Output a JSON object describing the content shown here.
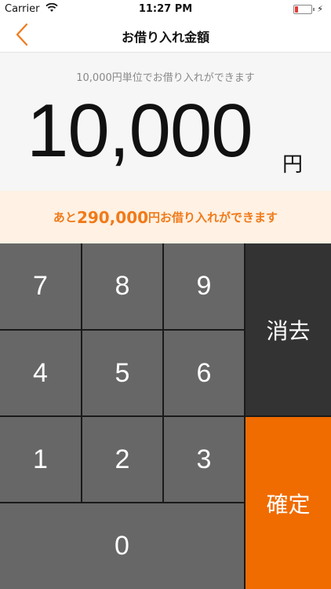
{
  "status_bar": {
    "carrier": "Carrier",
    "time": "11:27 PM",
    "battery_level": 0.15,
    "battery_color": "#e53935"
  },
  "nav": {
    "title": "お借り入れ金額",
    "back_icon": "chevron-left-icon",
    "accent": "#f07a1a"
  },
  "amount": {
    "hint": "10,000円単位でお借り入れができます",
    "value": "10,000",
    "unit": "円"
  },
  "remaining": {
    "prefix": "あと",
    "amount": "290,000",
    "unit": "円",
    "suffix": "お借り入れができます",
    "color": "#f07a1a"
  },
  "keypad": {
    "keys": [
      "7",
      "8",
      "9",
      "4",
      "5",
      "6",
      "1",
      "2",
      "3",
      "0"
    ],
    "delete_label": "消去",
    "confirm_label": "確定",
    "key_color": "#676767",
    "delete_color": "#333333",
    "confirm_color": "#f06b00"
  }
}
